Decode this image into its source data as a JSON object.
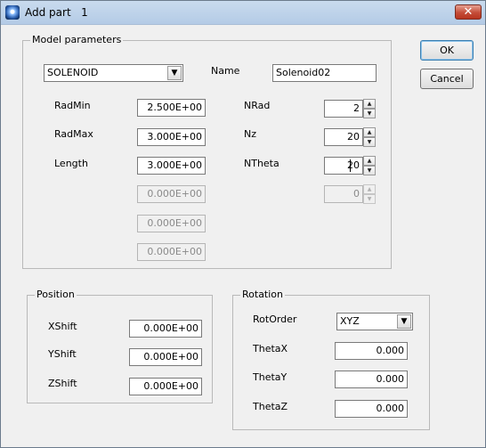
{
  "window": {
    "title": "Add part   1",
    "close_glyph": "✕",
    "icon": "app-orb-icon"
  },
  "buttons": {
    "ok": "OK",
    "cancel": "Cancel"
  },
  "model": {
    "group_label": "Model parameters",
    "type_value": "SOLENOID",
    "dropdown_glyph": "▼",
    "name_label": "Name",
    "name_value": "Solenoid02",
    "radmin_label": "RadMin",
    "radmin_value": "2.500E+00",
    "radmax_label": "RadMax",
    "radmax_value": "3.000E+00",
    "length_label": "Length",
    "length_value": "3.000E+00",
    "extra1_value": "0.000E+00",
    "extra2_value": "0.000E+00",
    "extra3_value": "0.000E+00",
    "nrad_label": "NRad",
    "nrad_value": "2",
    "nz_label": "Nz",
    "nz_value": "20",
    "ntheta_label": "NTheta",
    "ntheta_value": "20",
    "extra_count_value": "0",
    "spin_up_glyph": "▲",
    "spin_down_glyph": "▼"
  },
  "position": {
    "group_label": "Position",
    "xshift_label": "XShift",
    "xshift_value": "0.000E+00",
    "yshift_label": "YShift",
    "yshift_value": "0.000E+00",
    "zshift_label": "ZShift",
    "zshift_value": "0.000E+00"
  },
  "rotation": {
    "group_label": "Rotation",
    "rotorder_label": "RotOrder",
    "rotorder_value": "XYZ",
    "dropdown_glyph": "▼",
    "thetax_label": "ThetaX",
    "thetax_value": "0.000",
    "thetay_label": "ThetaY",
    "thetay_value": "0.000",
    "thetaz_label": "ThetaZ",
    "thetaz_value": "0.000"
  }
}
